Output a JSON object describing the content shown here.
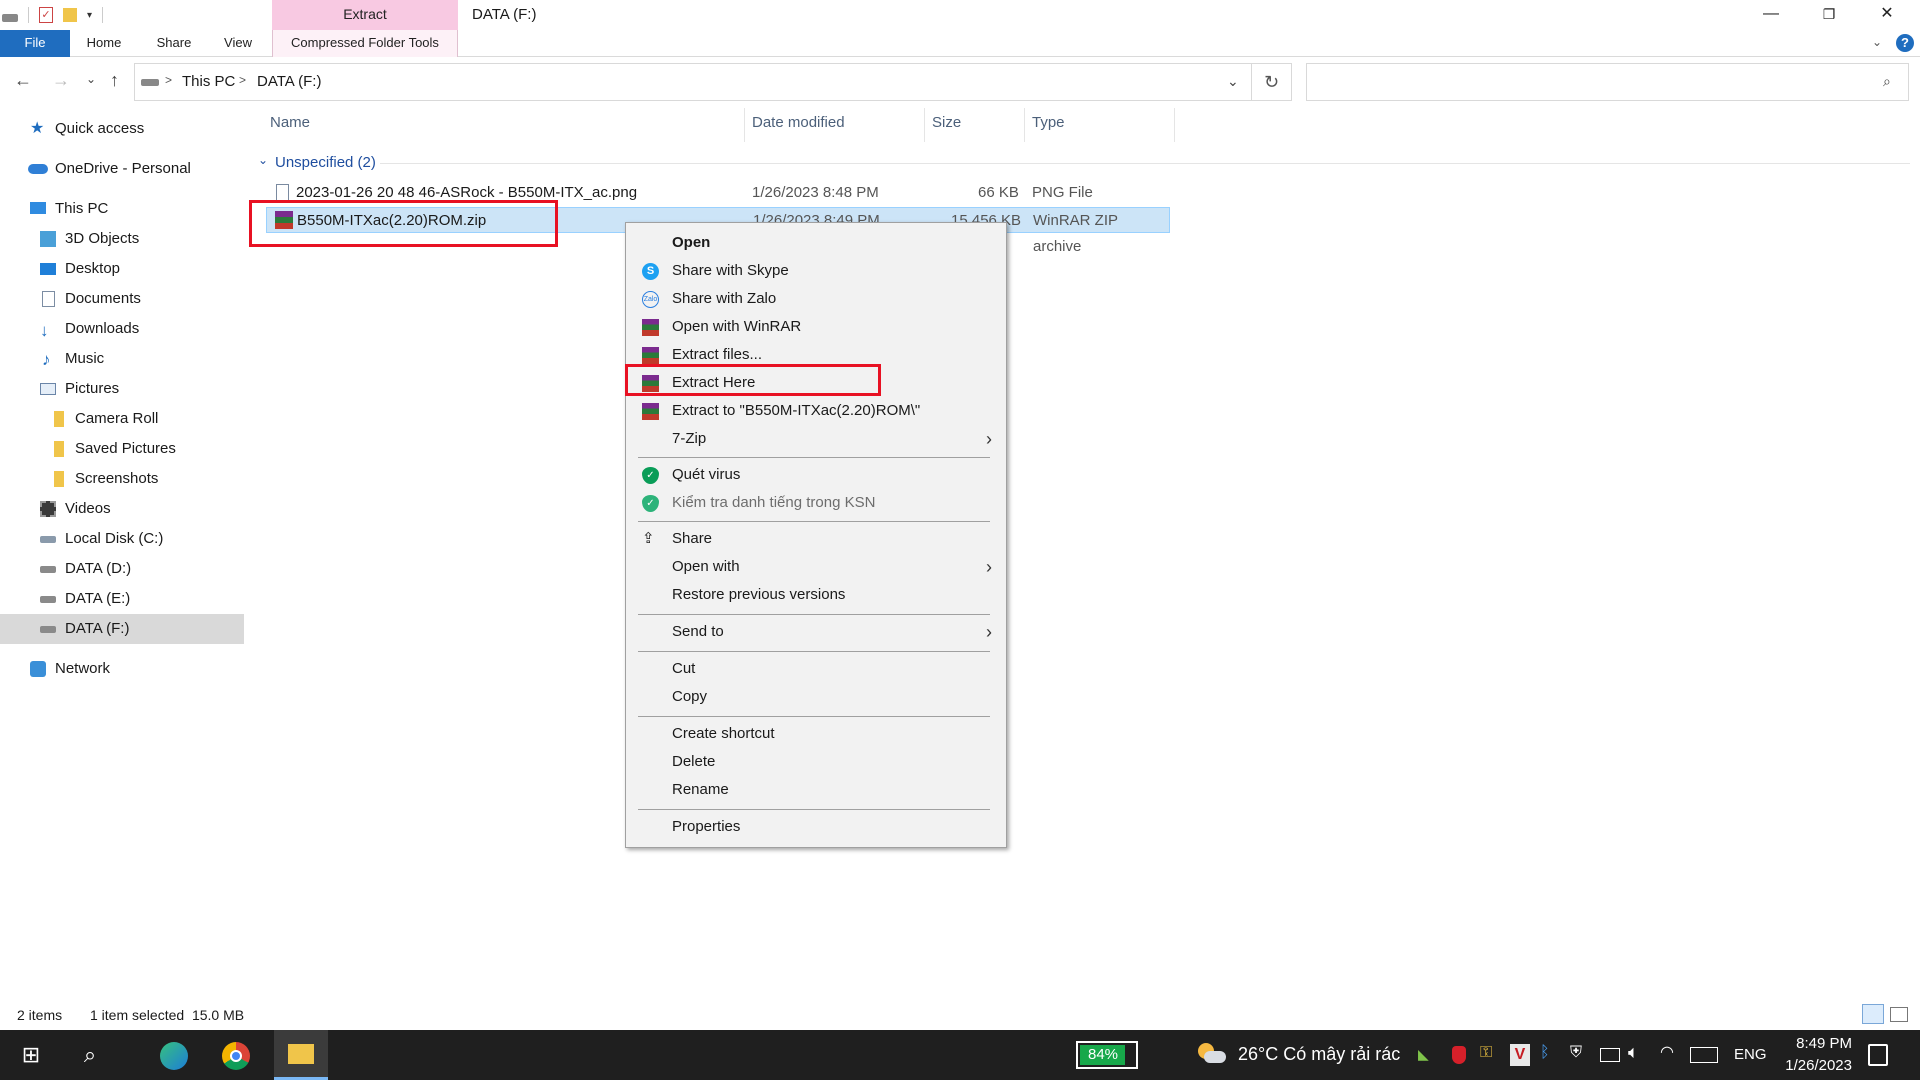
{
  "ribbon": {
    "contextual_header": "Extract",
    "tabs": {
      "file": "File",
      "home": "Home",
      "share": "Share",
      "view": "View",
      "compressed": "Compressed Folder Tools"
    }
  },
  "window": {
    "title": "DATA (F:)",
    "minimize": "—",
    "restore": "❐",
    "close": "✕"
  },
  "address": {
    "crumbs": [
      "This PC",
      "DATA (F:)"
    ],
    "separator": ">"
  },
  "sidebar": {
    "items": [
      "Quick access",
      "OneDrive - Personal",
      "This PC",
      "3D Objects",
      "Desktop",
      "Documents",
      "Downloads",
      "Music",
      "Pictures",
      "Camera Roll",
      "Saved Pictures",
      "Screenshots",
      "Videos",
      "Local Disk (C:)",
      "DATA (D:)",
      "DATA (E:)",
      "DATA (F:)",
      "Network"
    ]
  },
  "columns": {
    "name": "Name",
    "date": "Date modified",
    "size": "Size",
    "type": "Type"
  },
  "group": {
    "label": "Unspecified (2)"
  },
  "files": [
    {
      "name": "2023-01-26 20 48 46-ASRock - B550M-ITX_ac.png",
      "date": "1/26/2023 8:48 PM",
      "size": "66 KB",
      "type": "PNG File"
    },
    {
      "name": "B550M-ITXac(2.20)ROM.zip",
      "date": "1/26/2023 8:49 PM",
      "size": "15,456 KB",
      "type": "WinRAR ZIP archive"
    }
  ],
  "context_menu": {
    "open": "Open",
    "skype": "Share with Skype",
    "zalo": "Share with Zalo",
    "winrar": "Open with WinRAR",
    "extract_files": "Extract files...",
    "extract_here": "Extract Here",
    "extract_to": "Extract to \"B550M-ITXac(2.20)ROM\\\"",
    "sevenzip": "7-Zip",
    "scan": "Quét virus",
    "ksn": "Kiểm tra danh tiếng trong KSN",
    "share": "Share",
    "open_with": "Open with",
    "restore": "Restore previous versions",
    "send_to": "Send to",
    "cut": "Cut",
    "copy": "Copy",
    "create_shortcut": "Create shortcut",
    "delete": "Delete",
    "rename": "Rename",
    "properties": "Properties"
  },
  "status": {
    "items": "2 items",
    "selected": "1 item selected  15.0 MB"
  },
  "taskbar": {
    "battery": "84%",
    "weather": "26°C  Có mây rải rác",
    "lang": "ENG",
    "time": "8:49 PM",
    "date": "1/26/2023"
  },
  "colors": {
    "accent": "#1f6dbf",
    "selection": "#cce4f7",
    "highlight_box": "#e81123",
    "ctx_tab": "#f8c9e2",
    "taskbar": "#1f1f1f"
  }
}
